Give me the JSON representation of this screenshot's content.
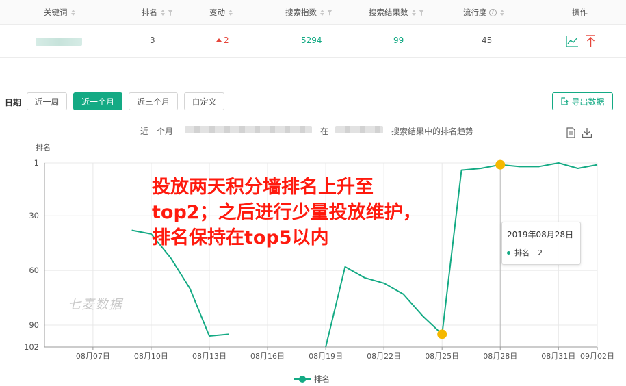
{
  "table": {
    "headers": [
      {
        "label": "关键词",
        "sort": true,
        "filter": false,
        "help": false
      },
      {
        "label": "排名",
        "sort": true,
        "filter": true,
        "help": false
      },
      {
        "label": "变动",
        "sort": true,
        "filter": false,
        "help": false
      },
      {
        "label": "搜索指数",
        "sort": true,
        "filter": true,
        "help": false
      },
      {
        "label": "搜索结果数",
        "sort": true,
        "filter": true,
        "help": false
      },
      {
        "label": "流行度",
        "sort": true,
        "filter": false,
        "help": true
      },
      {
        "label": "操作",
        "sort": false,
        "filter": false,
        "help": false
      }
    ],
    "row": {
      "rank": "3",
      "change": "2",
      "search_index": "5294",
      "result_count": "99",
      "popularity": "45"
    },
    "colors": {
      "green": "#14aa84",
      "red": "#e6453a"
    }
  },
  "filter": {
    "label": "日期",
    "ranges": [
      {
        "label": "近一周",
        "active": false
      },
      {
        "label": "近一个月",
        "active": true
      },
      {
        "label": "近三个月",
        "active": false
      },
      {
        "label": "自定义",
        "active": false
      }
    ],
    "export_label": "导出数据"
  },
  "chart_title": {
    "prefix": "近一个月",
    "middle": "在",
    "suffix": "搜索结果中的排名趋势"
  },
  "icons": [
    "document-icon",
    "download-icon",
    "trend-chart-icon",
    "pin-top-icon",
    "export-icon"
  ],
  "watermark": "七麦数据",
  "annotation": {
    "lines": [
      "投放两天积分墙排名上升至",
      "top2；之后进行少量投放维护，",
      "排名保持在top5以内"
    ]
  },
  "tooltip": {
    "date": "2019年08月28日",
    "series": "排名",
    "value": "2"
  },
  "chart_data": {
    "type": "line",
    "title": "",
    "ylabel": "排名",
    "xlabel": "",
    "y_inverted": true,
    "ylim": [
      1,
      102
    ],
    "y_ticks": [
      1,
      30,
      60,
      90,
      102
    ],
    "x_ticks": [
      "08月07日",
      "08月10日",
      "08月13日",
      "08月16日",
      "08月19日",
      "08月22日",
      "08月25日",
      "08月28日",
      "08月31日",
      "09月02日"
    ],
    "x_tick_index": [
      2,
      5,
      8,
      11,
      14,
      17,
      20,
      23,
      26,
      28
    ],
    "grid": true,
    "legend": "bottom",
    "line_color": "#14aa84",
    "highlight_color": "#f5b800",
    "series": [
      {
        "name": "排名",
        "values": [
          null,
          null,
          null,
          null,
          38,
          40,
          53,
          70,
          96,
          95,
          null,
          null,
          null,
          null,
          102,
          58,
          64,
          67,
          73,
          85,
          95,
          5,
          4,
          2,
          3,
          3,
          1,
          4,
          2
        ]
      }
    ],
    "highlight_points": [
      20,
      23
    ]
  }
}
